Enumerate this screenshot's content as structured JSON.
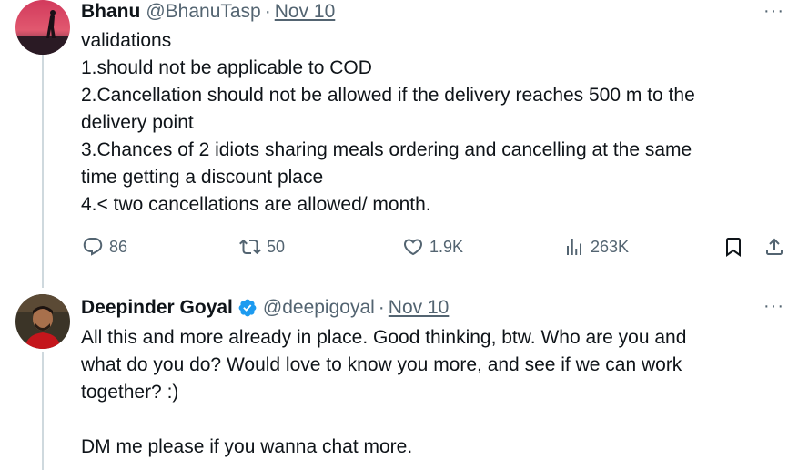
{
  "tweet1": {
    "display_name": "Bhanu",
    "handle": "@BhanuTasp",
    "separator": "·",
    "date": "Nov 10",
    "more": "···",
    "lines": [
      "validations",
      "1.should not be applicable to COD",
      "2.Cancellation should not be allowed if the delivery reaches 500 m to the",
      "delivery point",
      "3.Chances of 2 idiots sharing meals ordering and cancelling at the same",
      "time getting a discount place",
      "4.< two cancellations are allowed/ month."
    ],
    "actions": {
      "reply_count": "86",
      "retweet_count": "50",
      "like_count": "1.9K",
      "view_count": "263K"
    },
    "icons": [
      "reply-icon",
      "retweet-icon",
      "like-icon",
      "views-icon",
      "bookmark-icon",
      "share-icon"
    ]
  },
  "tweet2": {
    "display_name": "Deepinder Goyal",
    "handle": "@deepigoyal",
    "separator": "·",
    "date": "Nov 10",
    "more": "···",
    "verified_icon": "verified-badge-icon",
    "lines": [
      "All this and more already in place. Good thinking, btw. Who are you and",
      "what do you do? Would love to know you more, and see if we can work",
      "together? :)",
      "",
      "DM me please if you wanna chat more."
    ]
  },
  "colors": {
    "text": "#0f1419",
    "secondary": "#536471",
    "thread_line": "#cfd9de",
    "verified": "#1d9bf0"
  }
}
